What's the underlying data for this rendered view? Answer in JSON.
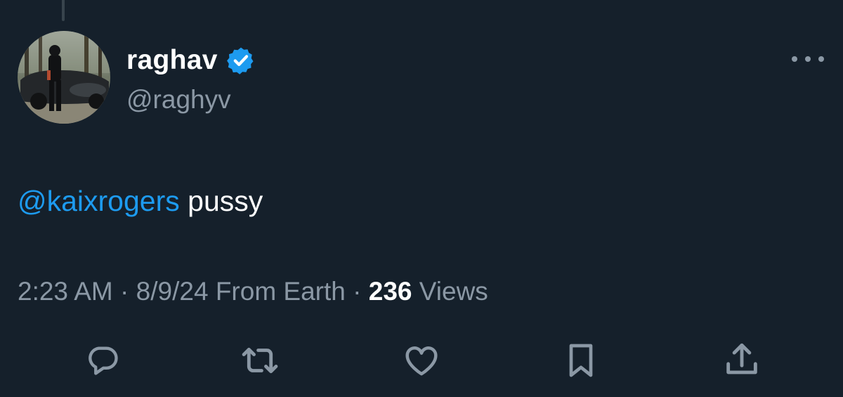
{
  "user": {
    "display_name": "raghav",
    "handle": "@raghyv",
    "verified": true,
    "avatar_alt": "profile-photo"
  },
  "tweet": {
    "mention": "@kaixrogers",
    "text": " pussy"
  },
  "meta": {
    "time": "2:23 AM",
    "separator": "·",
    "date": "8/9/24",
    "source": "From Earth",
    "view_count": "236",
    "views_label": "Views"
  },
  "actions": [
    {
      "icon": "reply-icon"
    },
    {
      "icon": "retweet-icon"
    },
    {
      "icon": "like-icon"
    },
    {
      "icon": "bookmark-icon"
    },
    {
      "icon": "share-icon"
    }
  ],
  "colors": {
    "background": "#15202b",
    "text": "#ffffff",
    "secondary": "#8b98a5",
    "accent": "#1d9bf0"
  }
}
